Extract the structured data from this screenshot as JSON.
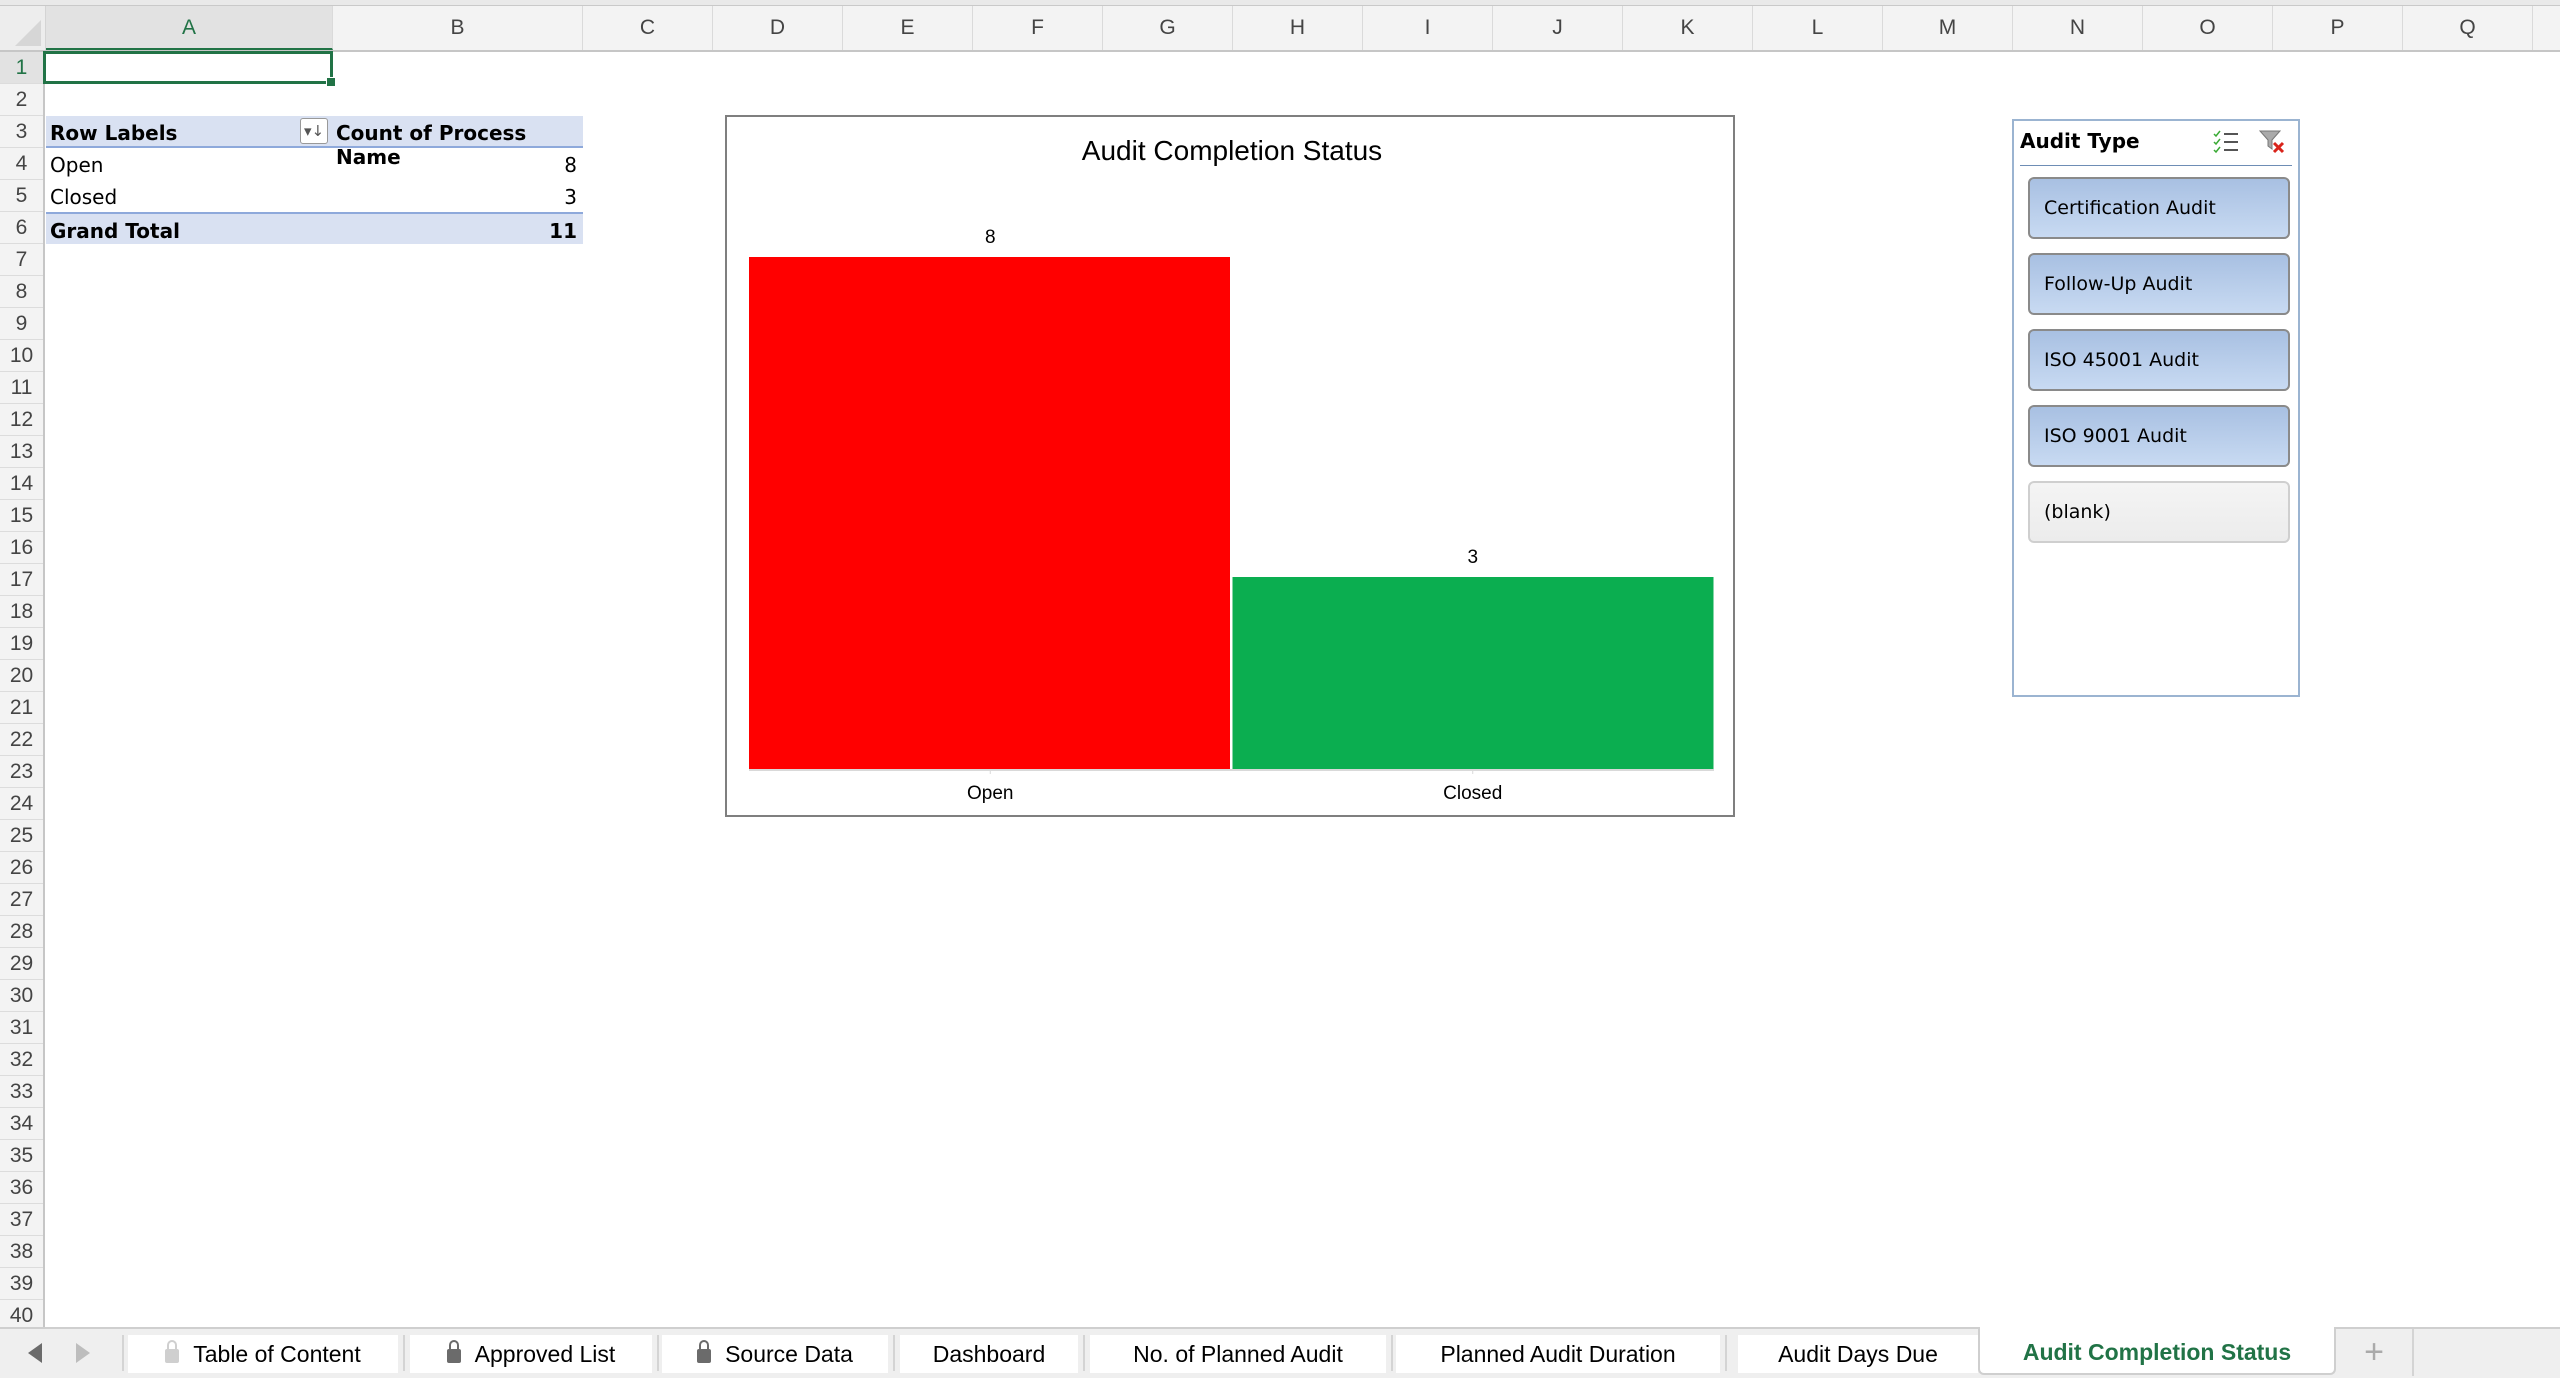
{
  "sheet": {
    "columns": [
      "A",
      "B",
      "C",
      "D",
      "E",
      "F",
      "G",
      "H",
      "I",
      "J",
      "K",
      "L",
      "M",
      "N",
      "O",
      "P",
      "Q"
    ],
    "selected_column": "A",
    "rows": [
      1,
      2,
      3,
      4,
      5,
      6,
      7,
      8,
      9,
      10,
      11,
      12,
      13,
      14,
      15,
      16,
      17,
      18,
      19,
      20,
      21,
      22,
      23,
      24,
      25,
      26,
      27,
      28,
      29,
      30,
      31,
      32,
      33,
      34,
      35,
      36,
      37,
      38,
      39,
      40
    ],
    "selected_row": 1,
    "selected_cell": "A1"
  },
  "pivot": {
    "header_label": "Row Labels",
    "header_value": "Count of Process Name",
    "filter_icon": "sort-filter-dropdown-icon",
    "rows": [
      {
        "label": "Open",
        "value": "8"
      },
      {
        "label": "Closed",
        "value": "3"
      }
    ],
    "total_label": "Grand Total",
    "total_value": "11"
  },
  "chart_data": {
    "type": "bar",
    "title": "Audit Completion Status",
    "categories": [
      "Open",
      "Closed"
    ],
    "values": [
      8,
      3
    ],
    "data_labels": [
      "8",
      "3"
    ],
    "colors": [
      "#ff0000",
      "#0bae50"
    ],
    "xlabel": "",
    "ylabel": "",
    "ylim": [
      0,
      8
    ],
    "grid": false,
    "legend": "none"
  },
  "slicer": {
    "title": "Audit Type",
    "multiselect_icon": "multi-select-icon",
    "clear_filter_icon": "clear-filter-icon",
    "items": [
      {
        "label": "Certification Audit",
        "selected": true
      },
      {
        "label": "Follow-Up Audit",
        "selected": true
      },
      {
        "label": "ISO 45001 Audit",
        "selected": true
      },
      {
        "label": "ISO 9001 Audit",
        "selected": true
      },
      {
        "label": "(blank)",
        "selected": false
      }
    ]
  },
  "tabs": {
    "items": [
      {
        "label": "Table of Content",
        "locked": true
      },
      {
        "label": "Approved List",
        "locked": true
      },
      {
        "label": "Source Data",
        "locked": true
      },
      {
        "label": "Dashboard",
        "locked": false
      },
      {
        "label": "No. of Planned Audit",
        "locked": false
      },
      {
        "label": "Planned Audit Duration",
        "locked": false
      },
      {
        "label": "Audit Days Due",
        "locked": false
      },
      {
        "label": "Audit Completion Status",
        "locked": false,
        "active": true
      }
    ],
    "add_label": "+"
  }
}
